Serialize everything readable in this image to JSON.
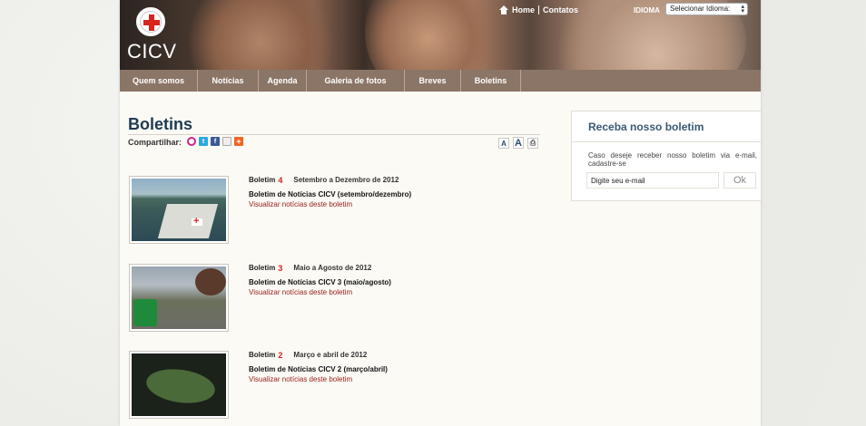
{
  "header": {
    "logo_text": "CICV",
    "top_links": {
      "home": "Home",
      "contacts": "Contatos"
    },
    "language": {
      "label": "IDIOMA",
      "selected": "Selecionar Idioma:"
    }
  },
  "nav": {
    "items": [
      {
        "label": "Quem somos"
      },
      {
        "label": "Notícias"
      },
      {
        "label": "Agenda"
      },
      {
        "label": "Galeria de fotos"
      },
      {
        "label": "Breves"
      },
      {
        "label": "Boletins"
      }
    ]
  },
  "main": {
    "title": "Boletins",
    "share_label": "Compartilhar:",
    "share_icons": [
      "orkut-icon",
      "twitter-icon",
      "facebook-icon",
      "email-icon",
      "share-more-icon"
    ],
    "font_tools": {
      "small": "A",
      "large": "A",
      "print": "⎙"
    },
    "entries": [
      {
        "label": "Boletim",
        "number": "4",
        "period": "Setembro a Dezembro de 2012",
        "name": "Boletim de Notícias CICV (setembro/dezembro)",
        "link": "Visualizar notícias deste boletim"
      },
      {
        "label": "Boletim",
        "number": "3",
        "period": "Maio a Agosto de 2012",
        "name": "Boletim de Notícias CICV 3 (maio/agosto)",
        "link": "Visualizar notícias deste boletim"
      },
      {
        "label": "Boletim",
        "number": "2",
        "period": "Março e abril de 2012",
        "name": "Boletim de Notícias CICV 2 (março/abril)",
        "link": "Visualizar notícias deste boletim"
      }
    ]
  },
  "newsletter": {
    "title": "Receba nosso boletim",
    "description": "Caso deseje receber nosso boletim via e-mail, cadastre-se",
    "email_value": "Digite seu e-mail",
    "ok_label": "Ok"
  },
  "colors": {
    "nav_bg": "#8b7566",
    "title": "#1e3a52",
    "link": "#9b1b15",
    "accent_red": "#c9261b"
  }
}
